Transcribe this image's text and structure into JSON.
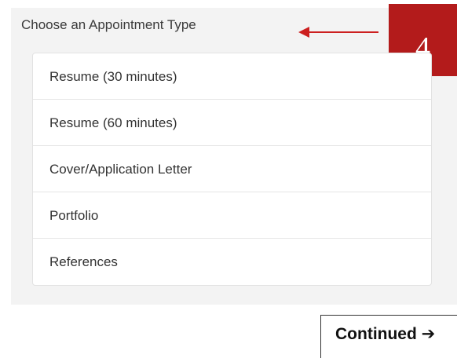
{
  "panel": {
    "title": "Choose an Appointment Type",
    "items": [
      {
        "label": "Resume (30 minutes)"
      },
      {
        "label": "Resume (60 minutes)"
      },
      {
        "label": "Cover/Application Letter"
      },
      {
        "label": "Portfolio"
      },
      {
        "label": "References"
      }
    ]
  },
  "annotation": {
    "step_number": "4",
    "arrow_icon": "left-arrow-icon",
    "arrow_color": "#cc1f1f",
    "badge_color": "#b31b1b"
  },
  "footer": {
    "continued_label": "Continued ➔"
  }
}
